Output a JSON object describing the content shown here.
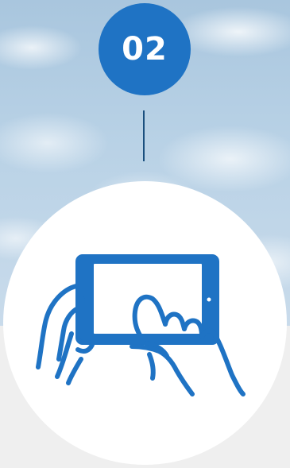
{
  "step": {
    "number": "02"
  },
  "illustration": {
    "icon": "tablet-touch-icon",
    "accent_color": "#1f73c4",
    "line_color": "#1a4f7e"
  }
}
